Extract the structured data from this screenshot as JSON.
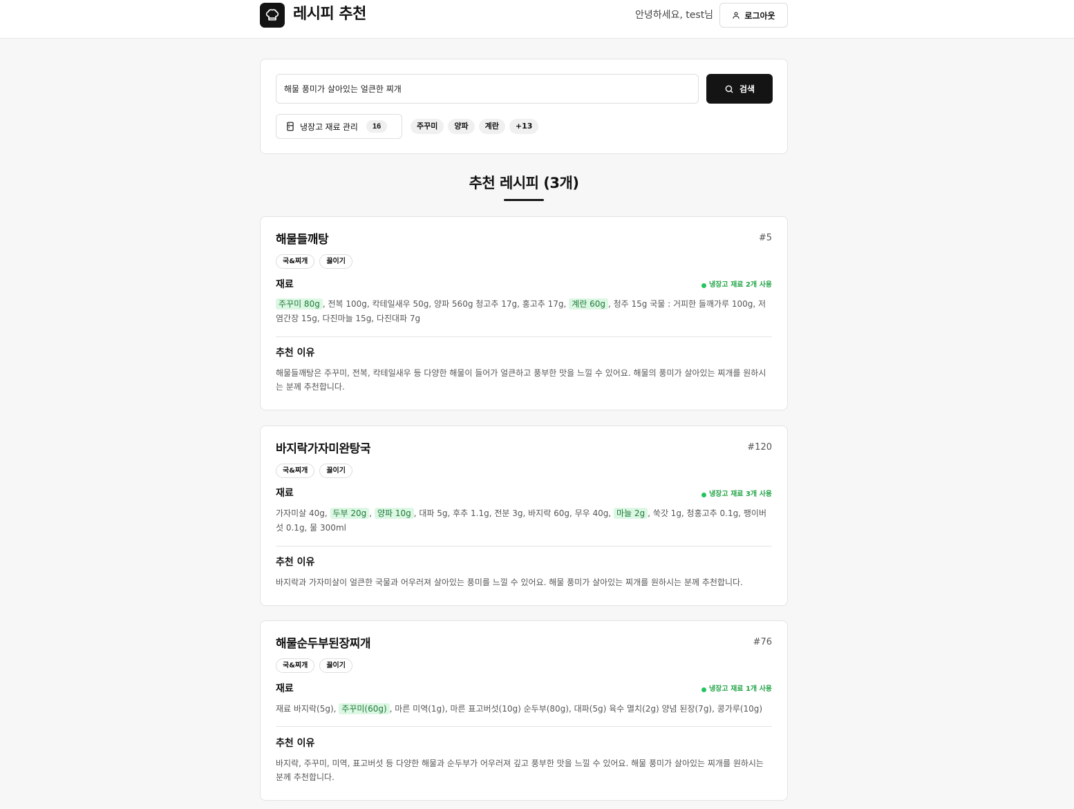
{
  "header": {
    "app_title": "레시피 추천",
    "greeting": "안녕하세요, test님",
    "logout_label": "로그아웃"
  },
  "search": {
    "query": "해물 풍미가 살아있는 얼큰한 찌개",
    "button_label": "검색"
  },
  "fridge": {
    "label": "냉장고 재료 관리",
    "count": "16",
    "chips": [
      "주꾸미",
      "양파",
      "계란",
      "+13"
    ]
  },
  "results": {
    "title": "추천 레시피 (3개)"
  },
  "labels": {
    "ingredients": "재료",
    "reason": "추천 이유"
  },
  "recipes": [
    {
      "title": "해물들깨탕",
      "id": "#5",
      "tags": [
        "국&찌개",
        "끓이기"
      ],
      "fridge_use": "냉장고 재료 2개 사용",
      "ingredients": [
        {
          "text": "주꾸미 80g",
          "hl": true
        },
        {
          "text": ", 전복 100g, 칵테일새우 50g, 양파 560g 청고추 17g, 홍고추 17g, ",
          "hl": false
        },
        {
          "text": "계란 60g",
          "hl": true
        },
        {
          "text": ", 청주 15g 국물 : 거피한 들깨가루 100g, 저염간장 15g, 다진마늘 15g, 다진대파 7g",
          "hl": false
        }
      ],
      "reason": "해물들깨탕은 주꾸미, 전복, 칵테일새우 등 다양한 해물이 들어가 얼큰하고 풍부한 맛을 느낄 수 있어요. 해물의 풍미가 살아있는 찌개를 원하시는 분께 추천합니다."
    },
    {
      "title": "바지락가자미완탕국",
      "id": "#120",
      "tags": [
        "국&찌개",
        "끓이기"
      ],
      "fridge_use": "냉장고 재료 3개 사용",
      "ingredients": [
        {
          "text": "가자미살 40g, ",
          "hl": false
        },
        {
          "text": "두부 20g",
          "hl": true
        },
        {
          "text": ", ",
          "hl": false
        },
        {
          "text": "양파 10g",
          "hl": true
        },
        {
          "text": ", 대파 5g, 후추 1.1g, 전분 3g, 바지락 60g, 무우 40g, ",
          "hl": false
        },
        {
          "text": "마늘 2g",
          "hl": true
        },
        {
          "text": ", 쑥갓 1g, 청홍고추 0.1g, 팽이버섯 0.1g, 물 300ml",
          "hl": false
        }
      ],
      "reason": "바지락과 가자미살이 얼큰한 국물과 어우러져 살아있는 풍미를 느낄 수 있어요. 해물 풍미가 살아있는 찌개를 원하시는 분께 추천합니다."
    },
    {
      "title": "해물순두부된장찌개",
      "id": "#76",
      "tags": [
        "국&찌개",
        "끓이기"
      ],
      "fridge_use": "냉장고 재료 1개 사용",
      "ingredients": [
        {
          "text": "재료 바지락(5g), ",
          "hl": false
        },
        {
          "text": "주꾸미(60g)",
          "hl": true
        },
        {
          "text": ", 마른 미역(1g), 마른 표고버섯(10g) 순두부(80g), 대파(5g) 육수 멸치(2g) 양념 된장(7g), 콩가루(10g)",
          "hl": false
        }
      ],
      "reason": "바지락, 주꾸미, 미역, 표고버섯 등 다양한 해물과 순두부가 어우러져 깊고 풍부한 맛을 느낄 수 있어요. 해물 풍미가 살아있는 찌개를 원하시는 분께 추천합니다."
    }
  ],
  "colors": {
    "accent": "#141414",
    "highlight_bg": "#dcf7e3",
    "highlight_text": "#1f7a3a",
    "fridge_use": "#22a447"
  }
}
